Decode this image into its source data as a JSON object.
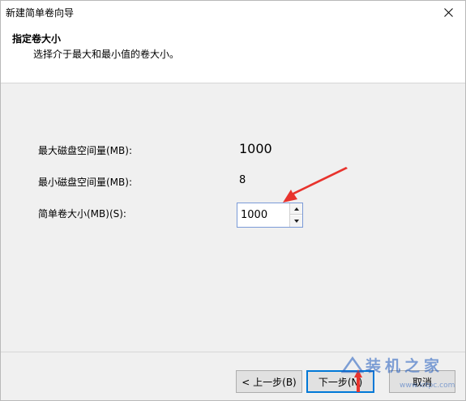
{
  "window": {
    "title": "新建简单卷向导"
  },
  "header": {
    "title": "指定卷大小",
    "subtitle": "选择介于最大和最小值的卷大小。"
  },
  "fields": {
    "max_label": "最大磁盘空间量(MB):",
    "max_value": "1000",
    "min_label": "最小磁盘空间量(MB):",
    "min_value": "8",
    "size_label": "简单卷大小(MB)(S):",
    "size_value": "1000"
  },
  "buttons": {
    "back": "< 上一步(B)",
    "next": "下一步(N)",
    "cancel": "取消"
  },
  "watermark": {
    "text": "装机之家",
    "url": "www.lotpc.com"
  },
  "colors": {
    "accent": "#0078d7",
    "annotation_arrow": "#e8332d"
  },
  "icons": {
    "close": "close-icon",
    "spin_up": "chevron-up-icon",
    "spin_down": "chevron-down-icon",
    "annotation": "red-arrow-icon"
  }
}
